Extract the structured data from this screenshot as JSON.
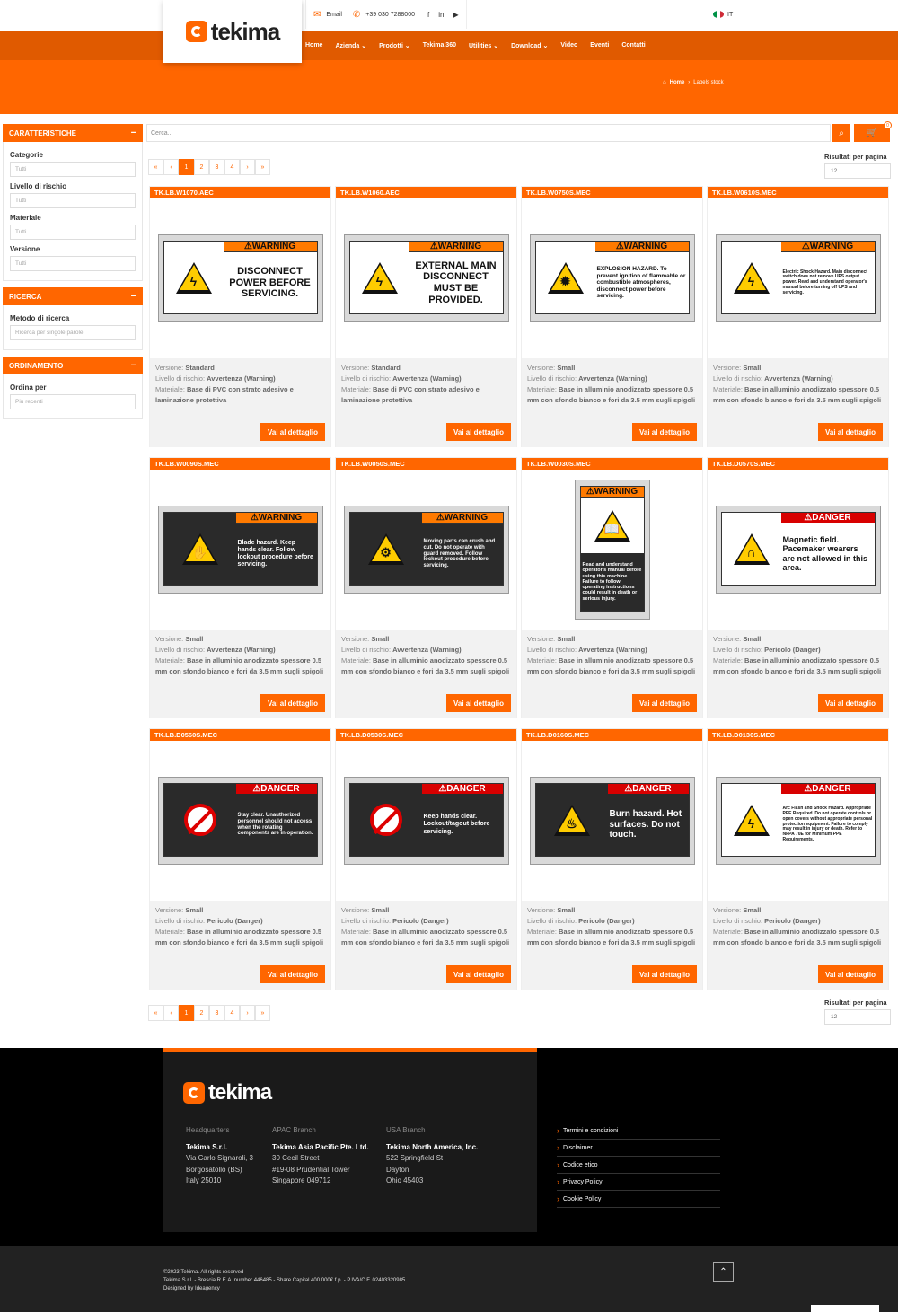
{
  "header": {
    "logo": "tekima",
    "email_label": "Email",
    "phone": "+39 030 7288000",
    "social": [
      "f",
      "in",
      "▶"
    ],
    "lang": "IT"
  },
  "nav": {
    "items": [
      {
        "label": "Home",
        "dropdown": false
      },
      {
        "label": "Azienda",
        "dropdown": true
      },
      {
        "label": "Prodotti",
        "dropdown": true
      },
      {
        "label": "Tekima 360",
        "dropdown": false
      },
      {
        "label": "Utilities",
        "dropdown": true
      },
      {
        "label": "Download",
        "dropdown": true
      },
      {
        "label": "Video",
        "dropdown": false
      },
      {
        "label": "Eventi",
        "dropdown": false
      },
      {
        "label": "Contatti",
        "dropdown": false
      }
    ]
  },
  "breadcrumb": {
    "home": "Home",
    "sep": "›",
    "current": "Labels stock"
  },
  "sidebar": {
    "caratteristiche": {
      "title": "CARATTERISTICHE",
      "fields": [
        {
          "label": "Categorie",
          "value": "Tutti"
        },
        {
          "label": "Livello di rischio",
          "value": "Tutti"
        },
        {
          "label": "Materiale",
          "value": "Tutti"
        },
        {
          "label": "Versione",
          "value": "Tutti"
        }
      ]
    },
    "ricerca": {
      "title": "RICERCA",
      "fields": [
        {
          "label": "Metodo di ricerca",
          "value": "Ricerca per singole parole"
        }
      ]
    },
    "ordinamento": {
      "title": "ORDINAMENTO",
      "fields": [
        {
          "label": "Ordina per",
          "value": "Più recenti"
        }
      ]
    },
    "collapse": "−"
  },
  "search": {
    "placeholder": "Cerca..",
    "cart_count": "0"
  },
  "pagination": [
    "«",
    "‹",
    "1",
    "2",
    "3",
    "4",
    "›",
    "»"
  ],
  "pagination_active": "1",
  "results_per_page": {
    "label": "Risultati per pagina",
    "value": "12"
  },
  "card_labels": {
    "versione": "Versione:",
    "livello": "Livello di rischio:",
    "materiale": "Materiale:",
    "button": "Vai al dettaglio"
  },
  "products": [
    {
      "code": "TK.LB.W1070.AEC",
      "versione": "Standard",
      "livello": "Avvertenza (Warning)",
      "materiale": "Base di PVC con strato adesivo e laminazione protettiva",
      "header": "⚠WARNING",
      "type": "warning",
      "body": "DISCONNECT POWER BEFORE SERVICING.",
      "sym": "ϟ"
    },
    {
      "code": "TK.LB.W1060.AEC",
      "versione": "Standard",
      "livello": "Avvertenza (Warning)",
      "materiale": "Base di PVC con strato adesivo e laminazione protettiva",
      "header": "⚠WARNING",
      "type": "warning",
      "body": "EXTERNAL MAIN DISCONNECT MUST BE PROVIDED.",
      "sym": "ϟ"
    },
    {
      "code": "TK.LB.W0750S.MEC",
      "versione": "Small",
      "livello": "Avvertenza (Warning)",
      "materiale": "Base in alluminio anodizzato spessore 0.5 mm con sfondo bianco e fori da 3.5 mm sugli spigoli",
      "header": "⚠WARNING",
      "type": "warning-small",
      "body": "EXPLOSION HAZARD. To prevent ignition of flammable or combustible atmospheres, disconnect power before servicing.",
      "sym": "✹"
    },
    {
      "code": "TK.LB.W0610S.MEC",
      "versione": "Small",
      "livello": "Avvertenza (Warning)",
      "materiale": "Base in alluminio anodizzato spessore 0.5 mm con sfondo bianco e fori da 3.5 mm sugli spigoli",
      "header": "⚠WARNING",
      "type": "warning-small",
      "body": "Electric Shock Hazard. Main disconnect switch does not remove UPS output power. Read and understand operator's manual before turning off UPS and servicing.",
      "sym": "ϟ"
    },
    {
      "code": "TK.LB.W0090S.MEC",
      "versione": "Small",
      "livello": "Avvertenza (Warning)",
      "materiale": "Base in alluminio anodizzato spessore 0.5 mm con sfondo bianco e fori da 3.5 mm sugli spigoli",
      "header": "⚠WARNING",
      "type": "warning-dark",
      "body": "Blade hazard. Keep hands clear. Follow lockout procedure before servicing.",
      "sym": "✋"
    },
    {
      "code": "TK.LB.W0050S.MEC",
      "versione": "Small",
      "livello": "Avvertenza (Warning)",
      "materiale": "Base in alluminio anodizzato spessore 0.5 mm con sfondo bianco e fori da 3.5 mm sugli spigoli",
      "header": "⚠WARNING",
      "type": "warning-dark",
      "body": "Moving parts can crush and cut. Do not operate with guard removed. Follow lockout procedure before servicing.",
      "sym": "⚙"
    },
    {
      "code": "TK.LB.W0030S.MEC",
      "versione": "Small",
      "livello": "Avvertenza (Warning)",
      "materiale": "Base in alluminio anodizzato spessore 0.5 mm con sfondo bianco e fori da 3.5 mm sugli spigoli",
      "header": "⚠WARNING",
      "type": "portrait",
      "body": "Read and understand operator's manual before using this machine. Failure to follow operating instructions could result in death or serious injury.",
      "sym": "📖"
    },
    {
      "code": "TK.LB.D0570S.MEC",
      "versione": "Small",
      "livello": "Pericolo (Danger)",
      "materiale": "Base in alluminio anodizzato spessore 0.5 mm con sfondo bianco e fori da 3.5 mm sugli spigoli",
      "header": "⚠DANGER",
      "type": "danger-white",
      "body": "Magnetic field. Pacemaker wearers are not allowed in this area.",
      "sym": "∩"
    },
    {
      "code": "TK.LB.D0560S.MEC",
      "versione": "Small",
      "livello": "Pericolo (Danger)",
      "materiale": "Base in alluminio anodizzato spessore 0.5 mm con sfondo bianco e fori da 3.5 mm sugli spigoli",
      "header": "⚠DANGER",
      "type": "danger-dark",
      "body": "Stay clear. Unauthorized personnel should not access when the rotating components are in operation.",
      "sym": "noent"
    },
    {
      "code": "TK.LB.D0530S.MEC",
      "versione": "Small",
      "livello": "Pericolo (Danger)",
      "materiale": "Base in alluminio anodizzato spessore 0.5 mm con sfondo bianco e fori da 3.5 mm sugli spigoli",
      "header": "⚠DANGER",
      "type": "danger-dark",
      "body": "Keep hands clear. Lockout/tagout before servicing.",
      "sym": "noent"
    },
    {
      "code": "TK.LB.D0160S.MEC",
      "versione": "Small",
      "livello": "Pericolo (Danger)",
      "materiale": "Base in alluminio anodizzato spessore 0.5 mm con sfondo bianco e fori da 3.5 mm sugli spigoli",
      "header": "⚠DANGER",
      "type": "danger-dark",
      "body": "Burn hazard. Hot surfaces. Do not touch.",
      "sym": "♨"
    },
    {
      "code": "TK.LB.D0130S.MEC",
      "versione": "Small",
      "livello": "Pericolo (Danger)",
      "materiale": "Base in alluminio anodizzato spessore 0.5 mm con sfondo bianco e fori da 3.5 mm sugli spigoli",
      "header": "⚠DANGER",
      "type": "danger-white",
      "body": "Arc Flash and Shock Hazard. Appropriate PPE Required. Do not operate controls or open covers without appropriate personal protection equipment. Failure to comply may result in injury or death. Refer to NFPA 70E for Minimum PPE Requirements.",
      "sym": "ϟ"
    }
  ],
  "footer": {
    "logo": "tekima",
    "columns": [
      {
        "heading": "Headquarters",
        "name": "Tekima S.r.l.",
        "lines": [
          "Via Carlo Signaroli, 3",
          "Borgosatollo (BS)",
          "Italy 25010"
        ]
      },
      {
        "heading": "APAC Branch",
        "name": "Tekima Asia Pacific Pte. Ltd.",
        "lines": [
          "30 Cecil Street",
          "#19-08 Prudential Tower",
          "Singapore 049712"
        ]
      },
      {
        "heading": "USA Branch",
        "name": "Tekima North America, Inc.",
        "lines": [
          "522 Springfield St",
          "Dayton",
          "Ohio 45403"
        ]
      }
    ],
    "links": [
      "Termini e condizioni",
      "Disclaimer",
      "Codice etico",
      "Privacy Policy",
      "Cookie Policy"
    ],
    "copyright": [
      "©2023 Tekima. All rights reserved",
      "Tekima S.r.l. - Brescia R.E.A. number 446485 - Share Capital 400.000€ f.p. - P.IVA/C.F. 02403320985",
      "Designed by Ideagency"
    ]
  }
}
